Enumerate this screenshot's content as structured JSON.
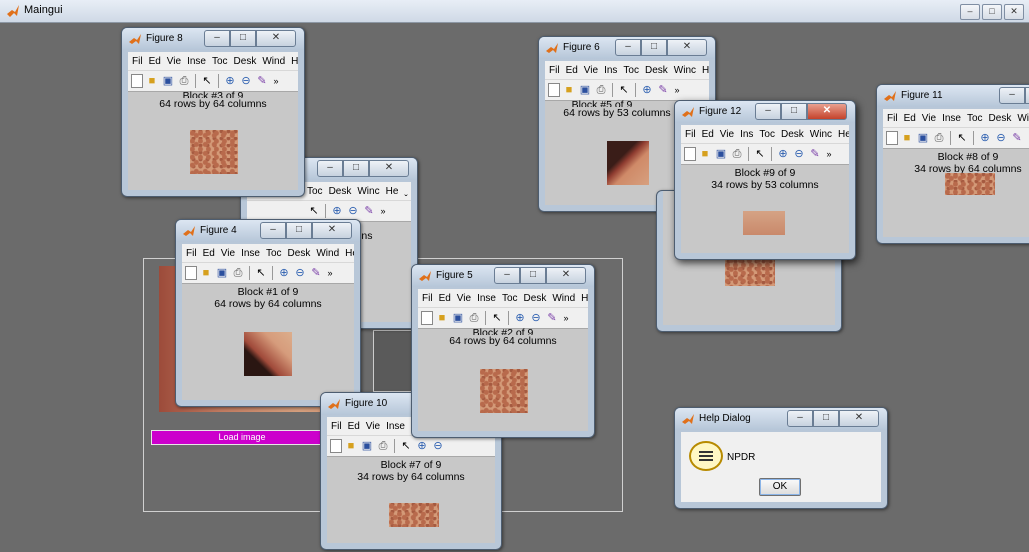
{
  "main_window": {
    "title": "Maingui"
  },
  "menu": [
    "Fil",
    "Ed",
    "Vie",
    "Inse",
    "Toc",
    "Desk",
    "Wind",
    "He",
    "ˬ"
  ],
  "menu_narrow": [
    "Fil",
    "Ed",
    "Vie",
    "Ins",
    "Toc",
    "Desk",
    "Winc",
    "He",
    "ˬ"
  ],
  "toolbar_more": "»",
  "load_button": "Load image",
  "figures": {
    "f8": {
      "title": "Figure 8",
      "block": "Block #3 of 9",
      "dims": "64 rows by 64 columns"
    },
    "f6": {
      "title": "Figure 6",
      "block": "Block #5 of 9",
      "dims": "64 rows by 53 columns"
    },
    "f12": {
      "title": "Figure 12",
      "block": "Block #9 of 9",
      "dims": "34 rows by 53 columns"
    },
    "f11": {
      "title": "Figure 11",
      "block": "Block #8 of 9",
      "dims": "34 rows by 64 columns"
    },
    "f4": {
      "title": "Figure 4",
      "block": "Block #1 of 9",
      "dims": "64 rows by 64 columns"
    },
    "f5": {
      "title": "Figure 5",
      "block": "Block #2 of 9",
      "dims": "64 rows by 64 columns"
    },
    "f10": {
      "title": "Figure 10",
      "block": "Block #7 of 9",
      "dims": "34 rows by 64 columns"
    },
    "f_hidden": {
      "dims_partial": "nns"
    }
  },
  "help_dialog": {
    "title": "Help Dialog",
    "message": "NPDR",
    "ok": "OK"
  }
}
